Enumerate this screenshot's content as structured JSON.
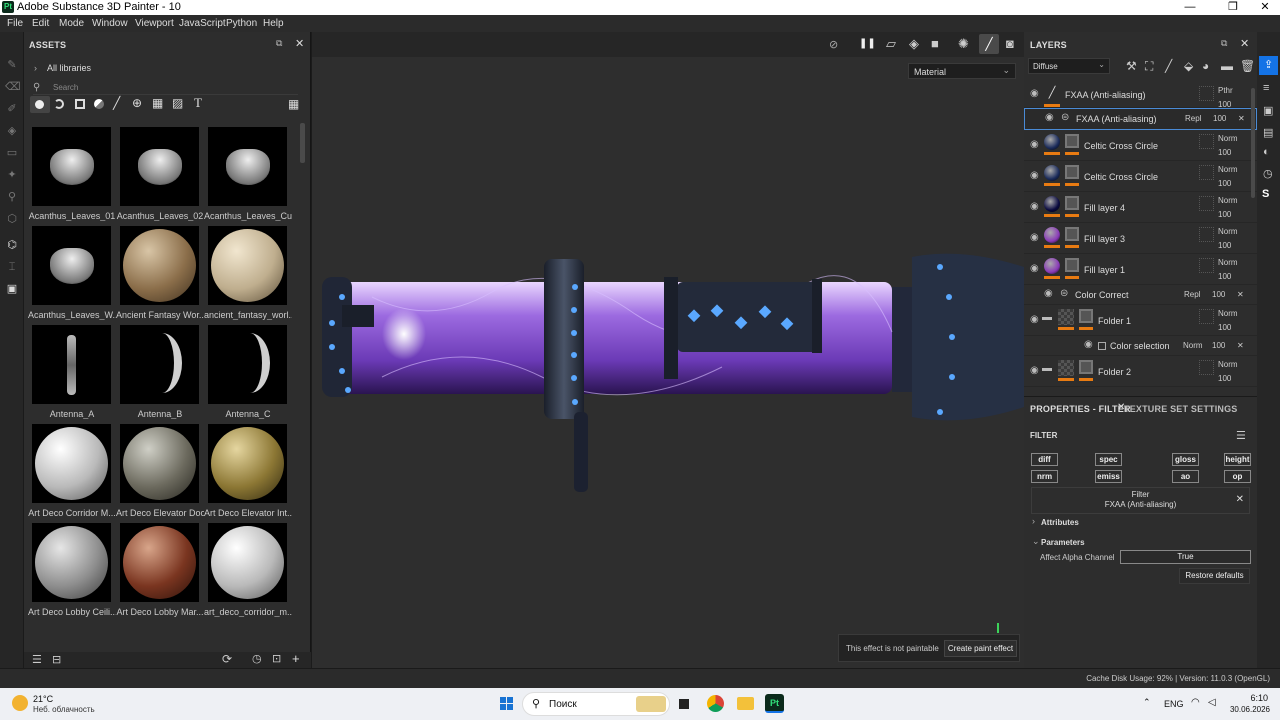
{
  "window": {
    "title": "Adobe Substance 3D Painter - 10",
    "app_badge": "Pt"
  },
  "menu": [
    "File",
    "Edit",
    "Mode",
    "Window",
    "Viewport",
    "JavaScript",
    "Python",
    "Help"
  ],
  "assets": {
    "title": "ASSETS",
    "library": "All libraries",
    "search_placeholder": "Search",
    "items": [
      {
        "label": "Acanthus_Leaves_01",
        "kind": "leaf"
      },
      {
        "label": "Acanthus_Leaves_02",
        "kind": "leaf"
      },
      {
        "label": "Acanthus_Leaves_Cu...",
        "kind": "leaf"
      },
      {
        "label": "Acanthus_Leaves_W...",
        "kind": "leaf"
      },
      {
        "label": "Ancient Fantasy Wor...",
        "kind": "stone"
      },
      {
        "label": "ancient_fantasy_worl...",
        "kind": "stone2"
      },
      {
        "label": "Antenna_A",
        "kind": "antenna"
      },
      {
        "label": "Antenna_B",
        "kind": "horn"
      },
      {
        "label": "Antenna_C",
        "kind": "horn"
      },
      {
        "label": "Art Deco Corridor M...",
        "kind": "scale"
      },
      {
        "label": "Art Deco Elevator Door",
        "kind": "metal"
      },
      {
        "label": "Art Deco Elevator Int...",
        "kind": "gold"
      },
      {
        "label": "Art Deco Lobby Ceili...",
        "kind": "grey"
      },
      {
        "label": "Art Deco Lobby Mar...",
        "kind": "red"
      },
      {
        "label": "art_deco_corridor_m...",
        "kind": "scale"
      }
    ]
  },
  "viewport": {
    "mode_select": "Material",
    "toast_text": "This effect is not paintable",
    "toast_button": "Create paint effect"
  },
  "layers": {
    "title": "LAYERS",
    "channel_select": "Diffuse",
    "rows": [
      {
        "name": "FXAA (Anti-aliasing)",
        "blend": "Pthr",
        "opacity": "100",
        "type": "paint",
        "thumb": ""
      },
      {
        "name": "FXAA (Anti-aliasing)",
        "blend": "Repl",
        "opacity": "100",
        "type": "filter",
        "thumb": ""
      },
      {
        "name": "Celtic Cross Circle",
        "blend": "Norm",
        "opacity": "100",
        "type": "fill",
        "thumb": "#1a2a5a"
      },
      {
        "name": "Celtic Cross Circle",
        "blend": "Norm",
        "opacity": "100",
        "type": "fill",
        "thumb": "#1a2a5a"
      },
      {
        "name": "Fill layer 4",
        "blend": "Norm",
        "opacity": "100",
        "type": "fill",
        "thumb": "#0a0a40"
      },
      {
        "name": "Fill layer 3",
        "blend": "Norm",
        "opacity": "100",
        "type": "fill",
        "thumb": "#8a3ab8"
      },
      {
        "name": "Fill layer 1",
        "blend": "Norm",
        "opacity": "100",
        "type": "fill",
        "thumb": "#8a3ab8"
      },
      {
        "name": "Color Correct",
        "blend": "Repl",
        "opacity": "100",
        "type": "filter",
        "thumb": ""
      },
      {
        "name": "Folder 1",
        "blend": "Norm",
        "opacity": "100",
        "type": "folder",
        "thumb": ""
      },
      {
        "name": "Color selection",
        "blend": "Norm",
        "opacity": "100",
        "type": "sub",
        "thumb": ""
      },
      {
        "name": "Folder 2",
        "blend": "Norm",
        "opacity": "100",
        "type": "folder",
        "thumb": ""
      }
    ]
  },
  "properties": {
    "tab_active": "PROPERTIES - FILTER",
    "tab_other": "TEXTURE SET SETTINGS",
    "section": "FILTER",
    "channels": [
      "diff",
      "spec",
      "gloss",
      "height",
      "nrm",
      "emiss",
      "ao",
      "op"
    ],
    "filter_label": "Filter",
    "filter_name": "FXAA (Anti-aliasing)",
    "attributes": "Attributes",
    "parameters": "Parameters",
    "param_label": "Affect Alpha Channel",
    "param_value": "True",
    "restore": "Restore defaults"
  },
  "status": {
    "text": "Cache Disk Usage:   92% | Version: 11.0.3 (OpenGL)"
  },
  "taskbar": {
    "temp": "21°C",
    "weather": "Неб. облачность",
    "search": "Поиск",
    "lang": "ENG",
    "time": "6:10",
    "date": "30.06.2026"
  },
  "colors": {
    "accent": "#1473e6",
    "orange": "#e87b12"
  }
}
